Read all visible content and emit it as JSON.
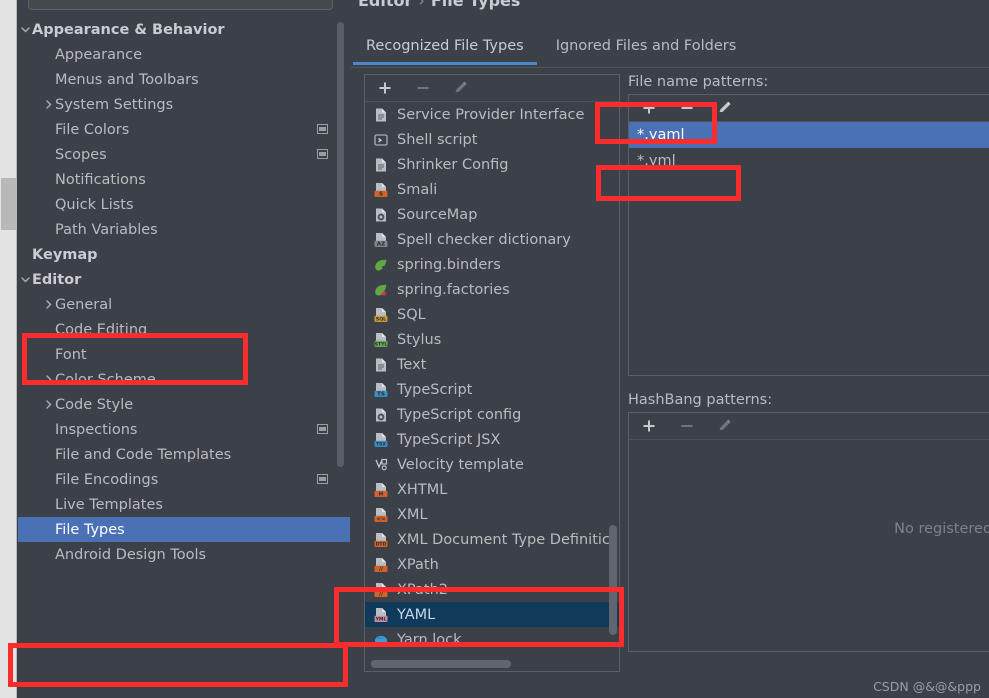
{
  "window": {
    "watermark": "CSDN @&@&ppp"
  },
  "search": {
    "placeholder": "",
    "value": "",
    "icon": "search-icon"
  },
  "sidebar": {
    "items": [
      {
        "label": "Appearance & Behavior",
        "indent": 0,
        "twisty": "chevron-down",
        "bold": true,
        "badge": false,
        "selected": false
      },
      {
        "label": "Appearance",
        "indent": 1,
        "twisty": "none",
        "bold": false,
        "badge": false,
        "selected": false
      },
      {
        "label": "Menus and Toolbars",
        "indent": 1,
        "twisty": "none",
        "bold": false,
        "badge": false,
        "selected": false
      },
      {
        "label": "System Settings",
        "indent": 1,
        "twisty": "chevron-right",
        "bold": false,
        "badge": false,
        "selected": false
      },
      {
        "label": "File Colors",
        "indent": 1,
        "twisty": "none",
        "bold": false,
        "badge": true,
        "selected": false
      },
      {
        "label": "Scopes",
        "indent": 1,
        "twisty": "none",
        "bold": false,
        "badge": true,
        "selected": false
      },
      {
        "label": "Notifications",
        "indent": 1,
        "twisty": "none",
        "bold": false,
        "badge": false,
        "selected": false
      },
      {
        "label": "Quick Lists",
        "indent": 1,
        "twisty": "none",
        "bold": false,
        "badge": false,
        "selected": false
      },
      {
        "label": "Path Variables",
        "indent": 1,
        "twisty": "none",
        "bold": false,
        "badge": false,
        "selected": false
      },
      {
        "label": "Keymap",
        "indent": 0,
        "twisty": "none",
        "bold": true,
        "badge": false,
        "selected": false
      },
      {
        "label": "Editor",
        "indent": 0,
        "twisty": "chevron-down",
        "bold": true,
        "badge": false,
        "selected": false
      },
      {
        "label": "General",
        "indent": 1,
        "twisty": "chevron-right",
        "bold": false,
        "badge": false,
        "selected": false
      },
      {
        "label": "Code Editing",
        "indent": 1,
        "twisty": "none",
        "bold": false,
        "badge": false,
        "selected": false
      },
      {
        "label": "Font",
        "indent": 1,
        "twisty": "none",
        "bold": false,
        "badge": false,
        "selected": false
      },
      {
        "label": "Color Scheme",
        "indent": 1,
        "twisty": "chevron-right",
        "bold": false,
        "badge": false,
        "selected": false
      },
      {
        "label": "Code Style",
        "indent": 1,
        "twisty": "chevron-right",
        "bold": false,
        "badge": false,
        "selected": false
      },
      {
        "label": "Inspections",
        "indent": 1,
        "twisty": "none",
        "bold": false,
        "badge": true,
        "selected": false
      },
      {
        "label": "File and Code Templates",
        "indent": 1,
        "twisty": "none",
        "bold": false,
        "badge": false,
        "selected": false
      },
      {
        "label": "File Encodings",
        "indent": 1,
        "twisty": "none",
        "bold": false,
        "badge": true,
        "selected": false
      },
      {
        "label": "Live Templates",
        "indent": 1,
        "twisty": "none",
        "bold": false,
        "badge": false,
        "selected": false
      },
      {
        "label": "File Types",
        "indent": 1,
        "twisty": "none",
        "bold": false,
        "badge": false,
        "selected": true
      },
      {
        "label": "Android Design Tools",
        "indent": 1,
        "twisty": "none",
        "bold": false,
        "badge": false,
        "selected": false
      }
    ]
  },
  "main": {
    "breadcrumb": {
      "parent": "Editor",
      "separator": "›",
      "current": "File Types"
    },
    "tabs": [
      {
        "label": "Recognized File Types",
        "active": true
      },
      {
        "label": "Ignored Files and Folders",
        "active": false
      }
    ],
    "list_toolbar": [
      {
        "name": "add",
        "icon": "plus-icon",
        "enabled": true
      },
      {
        "name": "remove",
        "icon": "minus-icon",
        "enabled": false
      },
      {
        "name": "edit",
        "icon": "pencil-icon",
        "enabled": false
      }
    ],
    "file_types": [
      {
        "label": "Service Provider Interface",
        "icon": "text-file-icon",
        "tag": "",
        "tagcolor": "",
        "selected": false
      },
      {
        "label": "Shell script",
        "icon": "shell-icon",
        "tag": "",
        "tagcolor": "",
        "selected": false
      },
      {
        "label": "Shrinker Config",
        "icon": "text-file-icon",
        "tag": "",
        "tagcolor": "",
        "selected": false
      },
      {
        "label": "Smali",
        "icon": "tagged-file-icon",
        "tag": "S",
        "tagcolor": "#d0622a",
        "selected": false
      },
      {
        "label": "SourceMap",
        "icon": "gear-file-icon",
        "tag": "",
        "tagcolor": "",
        "selected": false
      },
      {
        "label": "Spell checker dictionary",
        "icon": "tagged-file-icon",
        "tag": "AZ",
        "tagcolor": "#7f858b",
        "selected": false
      },
      {
        "label": "spring.binders",
        "icon": "spring-leaf-icon",
        "tag": "",
        "tagcolor": "",
        "selected": false
      },
      {
        "label": "spring.factories",
        "icon": "spring-star-icon",
        "tag": "",
        "tagcolor": "",
        "selected": false
      },
      {
        "label": "SQL",
        "icon": "tagged-file-icon",
        "tag": "SQL",
        "tagcolor": "#c79a3a",
        "selected": false
      },
      {
        "label": "Stylus",
        "icon": "tagged-file-icon",
        "tag": "STYL",
        "tagcolor": "#6aa84f",
        "selected": false
      },
      {
        "label": "Text",
        "icon": "text-file-icon",
        "tag": "",
        "tagcolor": "",
        "selected": false
      },
      {
        "label": "TypeScript",
        "icon": "tagged-file-icon",
        "tag": "TS",
        "tagcolor": "#3c8bc4",
        "selected": false
      },
      {
        "label": "TypeScript config",
        "icon": "gear-file-icon",
        "tag": "",
        "tagcolor": "",
        "selected": false
      },
      {
        "label": "TypeScript JSX",
        "icon": "tagged-file-icon",
        "tag": "TSX",
        "tagcolor": "#3c8bc4",
        "selected": false
      },
      {
        "label": "Velocity template",
        "icon": "velocity-icon",
        "tag": "",
        "tagcolor": "",
        "selected": false
      },
      {
        "label": "XHTML",
        "icon": "tagged-file-icon",
        "tag": "H",
        "tagcolor": "#d0622a",
        "selected": false
      },
      {
        "label": "XML",
        "icon": "tagged-file-icon",
        "tag": "<>",
        "tagcolor": "#d0622a",
        "selected": false
      },
      {
        "label": "XML Document Type Definitic",
        "icon": "tagged-file-icon",
        "tag": "DTD",
        "tagcolor": "#d0622a",
        "selected": false
      },
      {
        "label": "XPath",
        "icon": "tagged-file-icon",
        "tag": "//",
        "tagcolor": "#d0622a",
        "selected": false
      },
      {
        "label": "XPath2",
        "icon": "tagged-file-icon",
        "tag": "//",
        "tagcolor": "#d0622a",
        "selected": false
      },
      {
        "label": "YAML",
        "icon": "tagged-file-icon",
        "tag": "YML",
        "tagcolor": "#c98ba0",
        "selected": true
      },
      {
        "label": "Yarn lock",
        "icon": "yarn-icon",
        "tag": "",
        "tagcolor": "",
        "selected": false
      }
    ],
    "file_name_patterns": {
      "label": "File name patterns:",
      "toolbar": [
        {
          "name": "add",
          "icon": "plus-icon",
          "enabled": true
        },
        {
          "name": "remove",
          "icon": "minus-icon",
          "enabled": true
        },
        {
          "name": "edit",
          "icon": "pencil-icon",
          "enabled": true
        }
      ],
      "items": [
        {
          "value": "*.yaml",
          "selected": true
        },
        {
          "value": "*.yml",
          "selected": false
        }
      ]
    },
    "hashbang_patterns": {
      "label": "HashBang patterns:",
      "toolbar": [
        {
          "name": "add",
          "icon": "plus-icon",
          "enabled": true
        },
        {
          "name": "remove",
          "icon": "minus-icon",
          "enabled": false
        },
        {
          "name": "edit",
          "icon": "pencil-icon",
          "enabled": false
        }
      ],
      "empty_message": "No registered file patte"
    }
  },
  "colors": {
    "background": "#3c4149",
    "selection_focused": "#4a70b5",
    "selection_unfocused": "#103a5c",
    "tab_accent": "#4a88c7",
    "annotation_red": "#fb2c2c",
    "text": "#b9bcbf"
  },
  "annotations": [
    {
      "name": "editor-node-highlight"
    },
    {
      "name": "file-types-node-highlight"
    },
    {
      "name": "pattern-toolbar-highlight"
    },
    {
      "name": "yml-pattern-highlight"
    },
    {
      "name": "yaml-filetype-highlight"
    }
  ]
}
